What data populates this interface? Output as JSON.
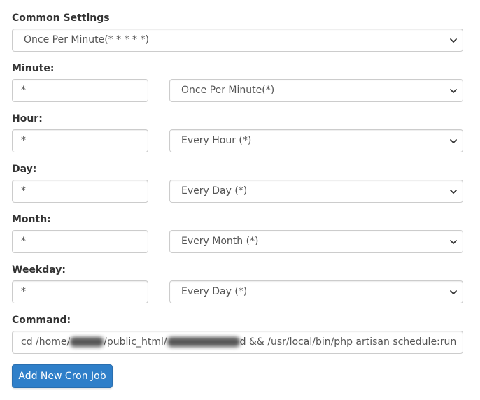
{
  "common_settings": {
    "label": "Common Settings",
    "selected": "Once Per Minute(* * * * *)"
  },
  "minute": {
    "label": "Minute:",
    "value": "*",
    "select": "Once Per Minute(*)"
  },
  "hour": {
    "label": "Hour:",
    "value": "*",
    "select": "Every Hour (*)"
  },
  "day": {
    "label": "Day:",
    "value": "*",
    "select": "Every Day (*)"
  },
  "month": {
    "label": "Month:",
    "value": "*",
    "select": "Every Month (*)"
  },
  "weekday": {
    "label": "Weekday:",
    "value": "*",
    "select": "Every Day (*)"
  },
  "command": {
    "label": "Command:",
    "prefix": "cd  /home/",
    "mid": "/public_html/",
    "suffix": "d && /usr/local/bin/php artisan schedule:run"
  },
  "add_button": {
    "label": "Add New Cron Job"
  },
  "icons": {
    "dropdown": "chevron-down-icon"
  },
  "colors": {
    "button_bg": "#2f7fc9",
    "border": "#cccccc",
    "text": "#333333"
  }
}
